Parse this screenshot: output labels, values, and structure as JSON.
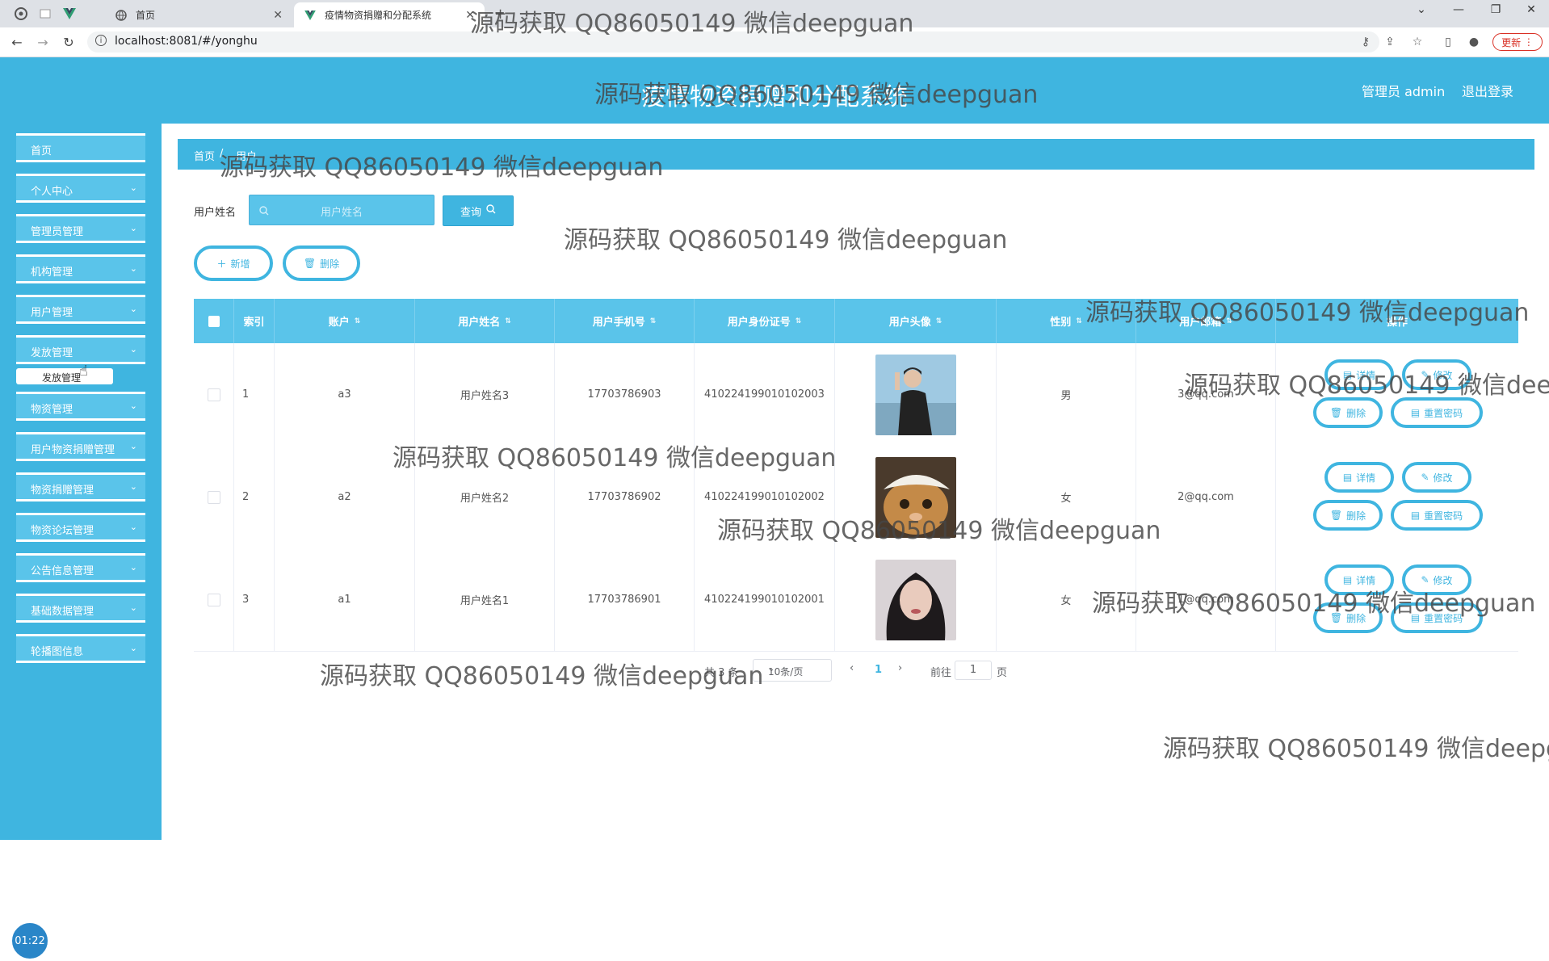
{
  "browser": {
    "inactive_tab_title": "首页",
    "active_tab_title": "疫情物资捐赠和分配系统",
    "new_tab_glyph": "+",
    "url": "localhost:8081/#/yonghu",
    "update_label": "更新"
  },
  "header": {
    "title": "疫情物资捐赠和分配系统",
    "admin_label": "管理员 admin",
    "logout_label": "退出登录"
  },
  "sidebar": {
    "items": [
      {
        "label": "首页"
      },
      {
        "label": "个人中心"
      },
      {
        "label": "管理员管理"
      },
      {
        "label": "机构管理"
      },
      {
        "label": "用户管理"
      },
      {
        "label": "发放管理"
      },
      {
        "label": "物资管理"
      },
      {
        "label": "用户物资捐赠管理"
      },
      {
        "label": "物资捐赠管理"
      },
      {
        "label": "物资论坛管理"
      },
      {
        "label": "公告信息管理"
      },
      {
        "label": "基础数据管理"
      },
      {
        "label": "轮播图信息"
      }
    ],
    "submenu_label": "发放管理",
    "timer": "01:22"
  },
  "breadcrumb": {
    "home": "首页",
    "separator": "/",
    "current": "用户"
  },
  "search": {
    "label": "用户姓名",
    "placeholder": "用户姓名",
    "query_label": "查询"
  },
  "actions": {
    "add_label": "新增",
    "delete_label": "删除"
  },
  "table": {
    "columns": {
      "index": "索引",
      "account": "账户",
      "name": "用户姓名",
      "phone": "用户手机号",
      "idcard": "用户身份证号",
      "avatar": "用户头像",
      "gender": "性别",
      "email": "用户邮箱",
      "ops": "操作"
    },
    "rows": [
      {
        "index": "1",
        "account": "a3",
        "name": "用户姓名3",
        "phone": "17703786903",
        "idcard": "410224199010102003",
        "gender": "男",
        "email": "3@qq.com"
      },
      {
        "index": "2",
        "account": "a2",
        "name": "用户姓名2",
        "phone": "17703786902",
        "idcard": "410224199010102002",
        "gender": "女",
        "email": "2@qq.com"
      },
      {
        "index": "3",
        "account": "a1",
        "name": "用户姓名1",
        "phone": "17703786901",
        "idcard": "410224199010102001",
        "gender": "女",
        "email": "1@qq.com"
      }
    ],
    "op_labels": {
      "detail": "详情",
      "edit": "修改",
      "remove": "删除",
      "reset": "重置密码"
    }
  },
  "pagination": {
    "total_label": "共 3 条",
    "page_size": "10条/页",
    "current_page": "1",
    "goto_label": "前往",
    "goto_value": "1",
    "page_suffix": "页"
  },
  "watermark": "源码获取 QQ86050149 微信deepguan",
  "colors": {
    "primary": "#3fb5e0",
    "primary_light": "#5ac4ea"
  }
}
